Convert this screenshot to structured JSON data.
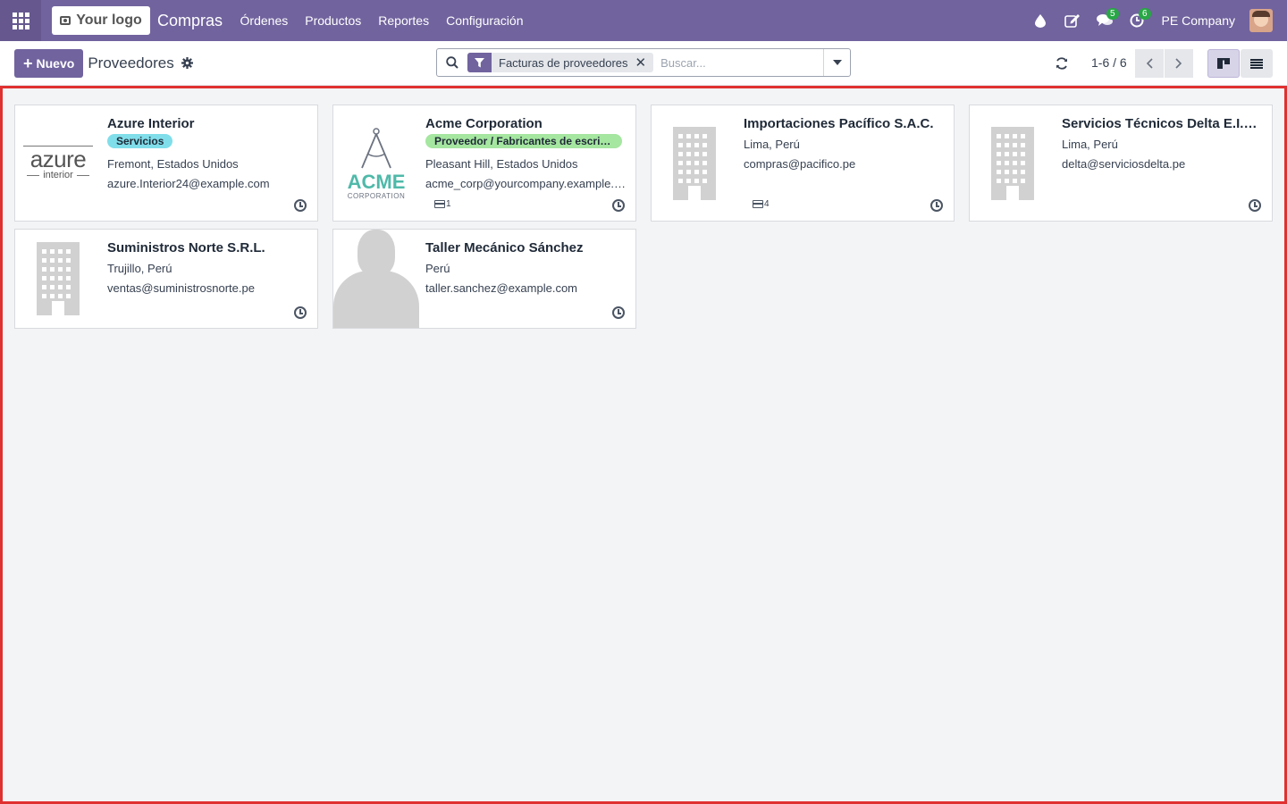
{
  "navbar": {
    "logo_text": "Your logo",
    "app_name": "Compras",
    "menu": [
      {
        "label": "Órdenes"
      },
      {
        "label": "Productos"
      },
      {
        "label": "Reportes"
      },
      {
        "label": "Configuración"
      }
    ],
    "messages_badge": "5",
    "activities_badge": "6",
    "company": "PE Company"
  },
  "control": {
    "new_label": "Nuevo",
    "breadcrumb": "Proveedores",
    "facet_label": "Facturas de proveedores",
    "search_placeholder": "Buscar...",
    "pager": "1-6 / 6"
  },
  "cards": [
    {
      "name": "Azure Interior",
      "tag": "Servicios",
      "line1": "Fremont, Estados Unidos",
      "line2": "azure.Interior24@example.com",
      "logo_main": "azure",
      "logo_sub": "interior"
    },
    {
      "name": "Acme Corporation",
      "tag": "Proveedor / Fabricantes de escritor...",
      "line1": "Pleasant Hill, Estados Unidos",
      "line2": "acme_corp@yourcompany.example.com",
      "count": "1",
      "logo_main": "ACME",
      "logo_sub": "CORPORATION"
    },
    {
      "name": "Importaciones Pacífico S.A.C.",
      "line1": "Lima, Perú",
      "line2": "compras@pacifico.pe",
      "count": "4"
    },
    {
      "name": "Servicios Técnicos Delta E.I.R.L.",
      "line1": "Lima, Perú",
      "line2": "delta@serviciosdelta.pe"
    },
    {
      "name": "Suministros Norte S.R.L.",
      "line1": "Trujillo, Perú",
      "line2": "ventas@suministrosnorte.pe"
    },
    {
      "name": "Taller Mecánico Sánchez",
      "line1": "Perú",
      "line2": "taller.sanchez@example.com"
    }
  ],
  "colors": {
    "brand": "#71639e",
    "tag_teal": "#80deea",
    "tag_green": "#a5e6a0",
    "highlight_border": "#e03131"
  }
}
